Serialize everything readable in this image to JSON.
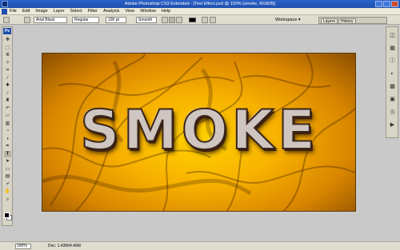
{
  "window": {
    "title": "Adobe Photoshop CS3 Extended - [Text Effect.psd @ 100% (smoke, RGB/8)]"
  },
  "menu": {
    "items": [
      "File",
      "Edit",
      "Image",
      "Layer",
      "Select",
      "Filter",
      "Analysis",
      "View",
      "Window",
      "Help"
    ]
  },
  "options": {
    "font_family": "Arial Black",
    "font_style": "Regular",
    "font_size": "100 pt",
    "antialias": "Smooth",
    "text_color": "#000000",
    "workspace_label": "Workspace ▾",
    "palette_tabs": [
      "Layers",
      "History"
    ]
  },
  "toolbox": {
    "badge": "Ps",
    "tools": [
      {
        "icon": "move-icon",
        "glyph": "✥"
      },
      {
        "icon": "marquee-icon",
        "glyph": "⬚"
      },
      {
        "icon": "lasso-icon",
        "glyph": "ᓬ"
      },
      {
        "icon": "magic-wand-icon",
        "glyph": "✧"
      },
      {
        "icon": "crop-icon",
        "glyph": "⌗"
      },
      {
        "icon": "slice-icon",
        "glyph": "⁄"
      },
      {
        "icon": "healing-brush-icon",
        "glyph": "✚"
      },
      {
        "icon": "brush-icon",
        "glyph": "∕"
      },
      {
        "icon": "clone-stamp-icon",
        "glyph": "♜"
      },
      {
        "icon": "history-brush-icon",
        "glyph": "↶"
      },
      {
        "icon": "eraser-icon",
        "glyph": "▱"
      },
      {
        "icon": "gradient-icon",
        "glyph": "▥"
      },
      {
        "icon": "blur-icon",
        "glyph": "◔"
      },
      {
        "icon": "dodge-icon",
        "glyph": "◖"
      },
      {
        "icon": "pen-icon",
        "glyph": "✒"
      },
      {
        "icon": "type-icon",
        "glyph": "T"
      },
      {
        "icon": "path-selection-icon",
        "glyph": "➤"
      },
      {
        "icon": "shape-icon",
        "glyph": "▭"
      },
      {
        "icon": "notes-icon",
        "glyph": "▤"
      },
      {
        "icon": "eyedropper-icon",
        "glyph": "⌿"
      },
      {
        "icon": "hand-icon",
        "glyph": "✋"
      },
      {
        "icon": "zoom-icon",
        "glyph": "⌕"
      }
    ]
  },
  "dock": {
    "icons": [
      {
        "icon": "navigator-icon",
        "glyph": "◫"
      },
      {
        "icon": "histogram-icon",
        "glyph": "▦"
      },
      {
        "icon": "info-icon",
        "glyph": "ⓘ"
      },
      {
        "icon": "color-icon",
        "glyph": "◐"
      },
      {
        "icon": "swatches-icon",
        "glyph": "▩"
      },
      {
        "icon": "styles-icon",
        "glyph": "▣"
      },
      {
        "icon": "history-icon",
        "glyph": "◷"
      },
      {
        "icon": "actions-icon",
        "glyph": "▶"
      }
    ]
  },
  "canvas": {
    "text": "SMOKE"
  },
  "status": {
    "zoom": "100%",
    "doc_info": "Doc: 1.43M/4.46M"
  },
  "colors": {
    "titlebar": "#1d4fae",
    "canvas_gold": "#f7b000"
  }
}
